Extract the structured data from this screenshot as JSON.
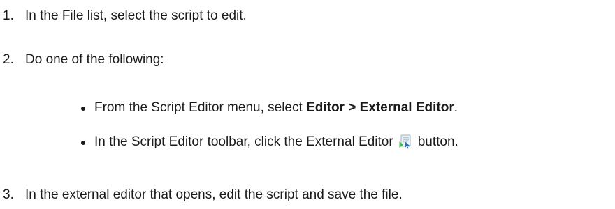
{
  "steps": [
    {
      "number": "1.",
      "text": "In the File list, select the script to edit."
    },
    {
      "number": "2.",
      "text": "Do one of the following:"
    },
    {
      "number": "3.",
      "text": "In the external editor that opens, edit the script and save the file."
    }
  ],
  "bullets": {
    "item1": {
      "before": "From the Script Editor menu, select ",
      "bold": "Editor > External Editor",
      "after": "."
    },
    "item2": {
      "before": "In the Script Editor toolbar, click the External Editor",
      "icon": "external-editor-icon",
      "after": "button."
    }
  }
}
